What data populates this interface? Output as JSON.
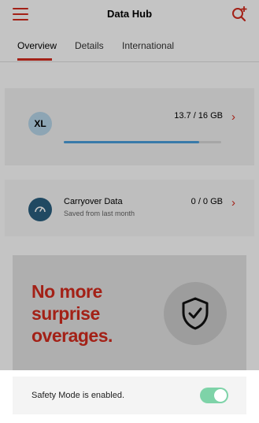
{
  "header": {
    "title": "Data Hub",
    "menu_icon": "hamburger-menu-icon",
    "add_search_icon": "search-plus-icon"
  },
  "tabs": [
    {
      "label": "Overview",
      "active": true
    },
    {
      "label": "Details",
      "active": false
    },
    {
      "label": "International",
      "active": false
    }
  ],
  "plan_card": {
    "badge": "XL",
    "usage": "13.7 / 16 GB",
    "usage_fraction": 0.86,
    "chevron": "›"
  },
  "carryover_card": {
    "title": "Carryover Data",
    "subtitle": "Saved from last month",
    "value": "0 / 0 GB",
    "chevron": "›",
    "icon": "gauge-icon"
  },
  "promo": {
    "line1": "No more",
    "line2": "surprise",
    "line3": "overages.",
    "icon": "shield-check-icon"
  },
  "safety_sheet": {
    "label": "Safety Mode is enabled.",
    "toggle_on": true
  },
  "colors": {
    "brand_red": "#d52b1e",
    "progress_blue": "#4b9fdc",
    "toggle_green": "#7ed3a8"
  }
}
